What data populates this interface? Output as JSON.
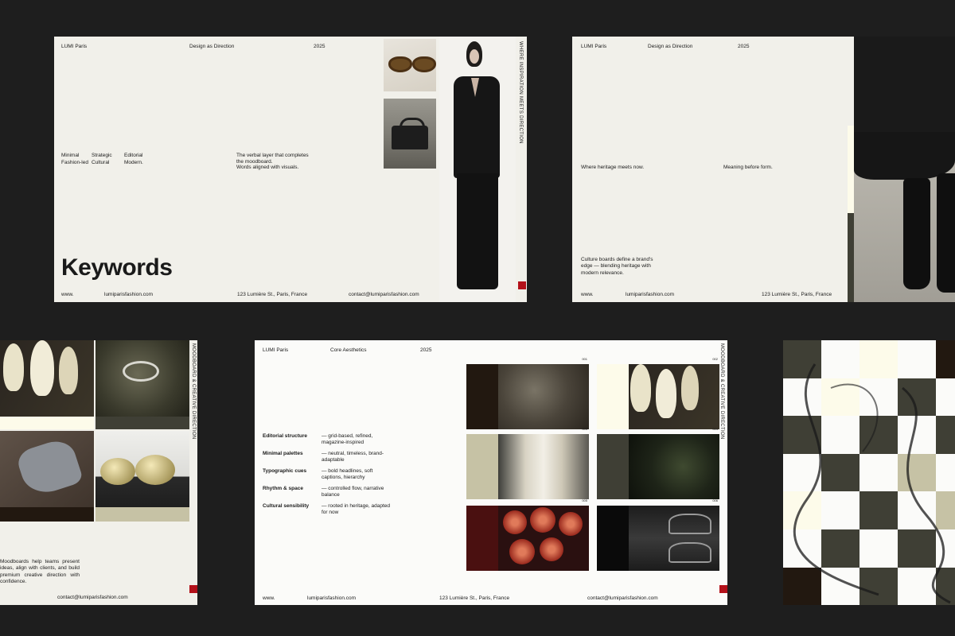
{
  "brand": "LUMI Paris",
  "slide1": {
    "subtitle": "Design as Direction",
    "year": "2025",
    "keywords_col1": [
      "Minimal",
      "Fashion-led"
    ],
    "keywords_col2": [
      "Strategic",
      "Cultural"
    ],
    "keywords_col3": [
      "Editorial",
      "Modern."
    ],
    "desc_line1": "The verbal layer that completes the moodboard.",
    "desc_line2": "Words aligned with visuals.",
    "vertical": "WHERE INSPIRATION MEETS DIRECTION",
    "title": "Keywords"
  },
  "slide2": {
    "subtitle": "Design as Direction",
    "year": "2025",
    "left_caption": "Where heritage meets now.",
    "right_caption": "Meaning before form.",
    "paragraph": "Culture boards define a brand's edge — blending heritage with modern relevance."
  },
  "slide3": {
    "vertical": "MOODBOARD & CREATIVE DIRECTION",
    "paragraph": "Moodboards help teams present ideas, align with clients, and build premium creative direction with confidence.",
    "email": "contact@lumiparisfashion.com"
  },
  "slide4": {
    "subtitle": "Core Aesthetics",
    "year": "2025",
    "vertical": "MOODBOARD & CREATIVE DIRECTION",
    "rows": [
      {
        "label": "Editorial structure",
        "desc": "— grid-based, refined, magazine-inspired"
      },
      {
        "label": "Minimal palettes",
        "desc": "— neutral, timeless, brand-adaptable"
      },
      {
        "label": "Typographic cues",
        "desc": "— bold headlines, soft captions, hierarchy"
      },
      {
        "label": "Rhythm & space",
        "desc": "— controlled flow, narrative balance"
      },
      {
        "label": "Cultural sensibility",
        "desc": "— rooted in heritage, adapted for now"
      }
    ],
    "tile_numbers": [
      "001",
      "002",
      "003",
      "004",
      "005",
      "006"
    ]
  },
  "footer": {
    "www": "www.",
    "site": "lumiparisfashion.com",
    "address": "123 Lumière St., Paris, France",
    "email": "contact@lumiparisfashion.com"
  },
  "colors": {
    "background": "#1e1e1e",
    "slide_cream": "#f1f0ea",
    "slide_white": "#fbfbf9",
    "accent_red": "#b3111a",
    "olive_dark": "#3f3f35",
    "sage": "#c6c2a5",
    "cream": "#fdfbea",
    "dark_brown": "#221810"
  }
}
